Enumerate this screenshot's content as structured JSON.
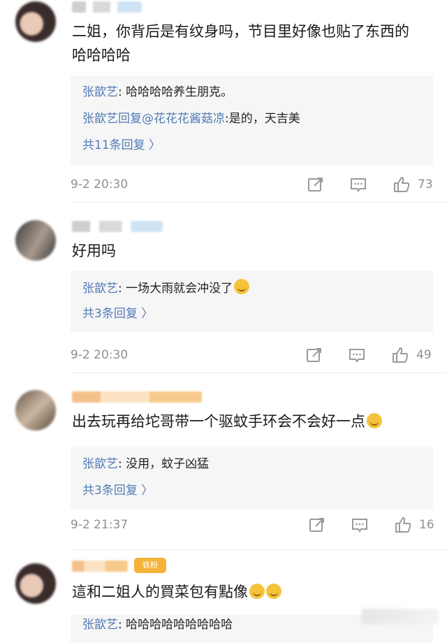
{
  "comments": [
    {
      "text": "二姐，你背后是有纹身吗，节目里好像也贴了东西的 哈哈哈哈",
      "replies": [
        {
          "name": "张歆艺",
          "sep": ": ",
          "text": "哈哈哈哈养生朋克。"
        },
        {
          "name": "张歆艺回复@花花花酱菇凉",
          "sep": ":",
          "text": "是的，天吉美"
        }
      ],
      "more": "共11条回复 〉",
      "time": "9-2 20:30",
      "likes": "73"
    },
    {
      "text": "好用吗",
      "replies": [
        {
          "name": "张歆艺",
          "sep": ": ",
          "text": "一场大雨就会冲没了"
        }
      ],
      "more": "共3条回复 〉",
      "time": "9-2 20:30",
      "likes": "49"
    },
    {
      "text": "出去玩再给坨哥带一个驱蚊手环会不会好一点",
      "replies": [
        {
          "name": "张歆艺",
          "sep": ": ",
          "text": "没用，蚊子凶猛"
        }
      ],
      "more": "共3条回复 〉",
      "time": "9-2 21:37",
      "likes": "16"
    },
    {
      "text": "這和二姐人的買菜包有點像",
      "badge": "铁粉",
      "replies": [
        {
          "name": "张歆艺",
          "sep": ": ",
          "text": "哈哈哈哈哈哈哈哈哈"
        }
      ]
    }
  ],
  "colors": {
    "link": "#527bb5",
    "meta": "#8f8f8f",
    "replyBg": "#f6f6f6",
    "badge": "#f3b23a"
  },
  "icons": [
    "share-icon",
    "comment-icon",
    "like-icon",
    "emoji-icon"
  ]
}
